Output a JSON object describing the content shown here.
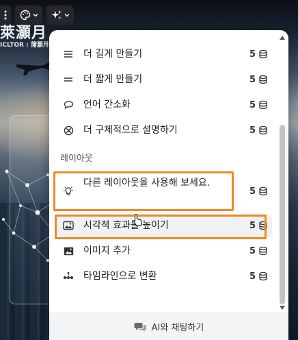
{
  "slide": {
    "title": "萊灝月",
    "subtitle": "ICLTOR : 蒲灝月 | 蒲灝"
  },
  "toolbar": {
    "more_icon": "vertical-dots-icon",
    "theme_icon": "palette-icon",
    "ai_icon": "sparkle-icon"
  },
  "menu": {
    "items_top": [
      {
        "label": "더 길게 만들기",
        "icon": "lines-icon",
        "cost": "5"
      },
      {
        "label": "더 짧게 만들기",
        "icon": "equals-icon",
        "cost": "5"
      },
      {
        "label": "언어 간소화",
        "icon": "speech-bubble-icon",
        "cost": "5"
      },
      {
        "label": "더 구체적으로 설명하기",
        "icon": "target-cross-icon",
        "cost": "5"
      }
    ],
    "section_layout": "레이아웃",
    "items_layout": [
      {
        "label": "다른 레이아웃을 사용해 보세요.",
        "icon": "lightbulb-icon",
        "cost": "5"
      },
      {
        "label": "시각적 효과를 높이기",
        "icon": "image-icon",
        "cost": "5"
      },
      {
        "label": "이미지 추가",
        "icon": "picture-icon",
        "cost": "5"
      },
      {
        "label": "타임라인으로 변환",
        "icon": "timeline-icon",
        "cost": "5"
      }
    ],
    "footer_label": "AI와 채팅하기",
    "footer_icon": "chat-bubbles-icon",
    "credit_icon": "coin-stack-icon"
  },
  "colors": {
    "highlight": "#f08a24",
    "panel_bg": "#ffffff",
    "footer_bg": "#f3f4f6"
  }
}
